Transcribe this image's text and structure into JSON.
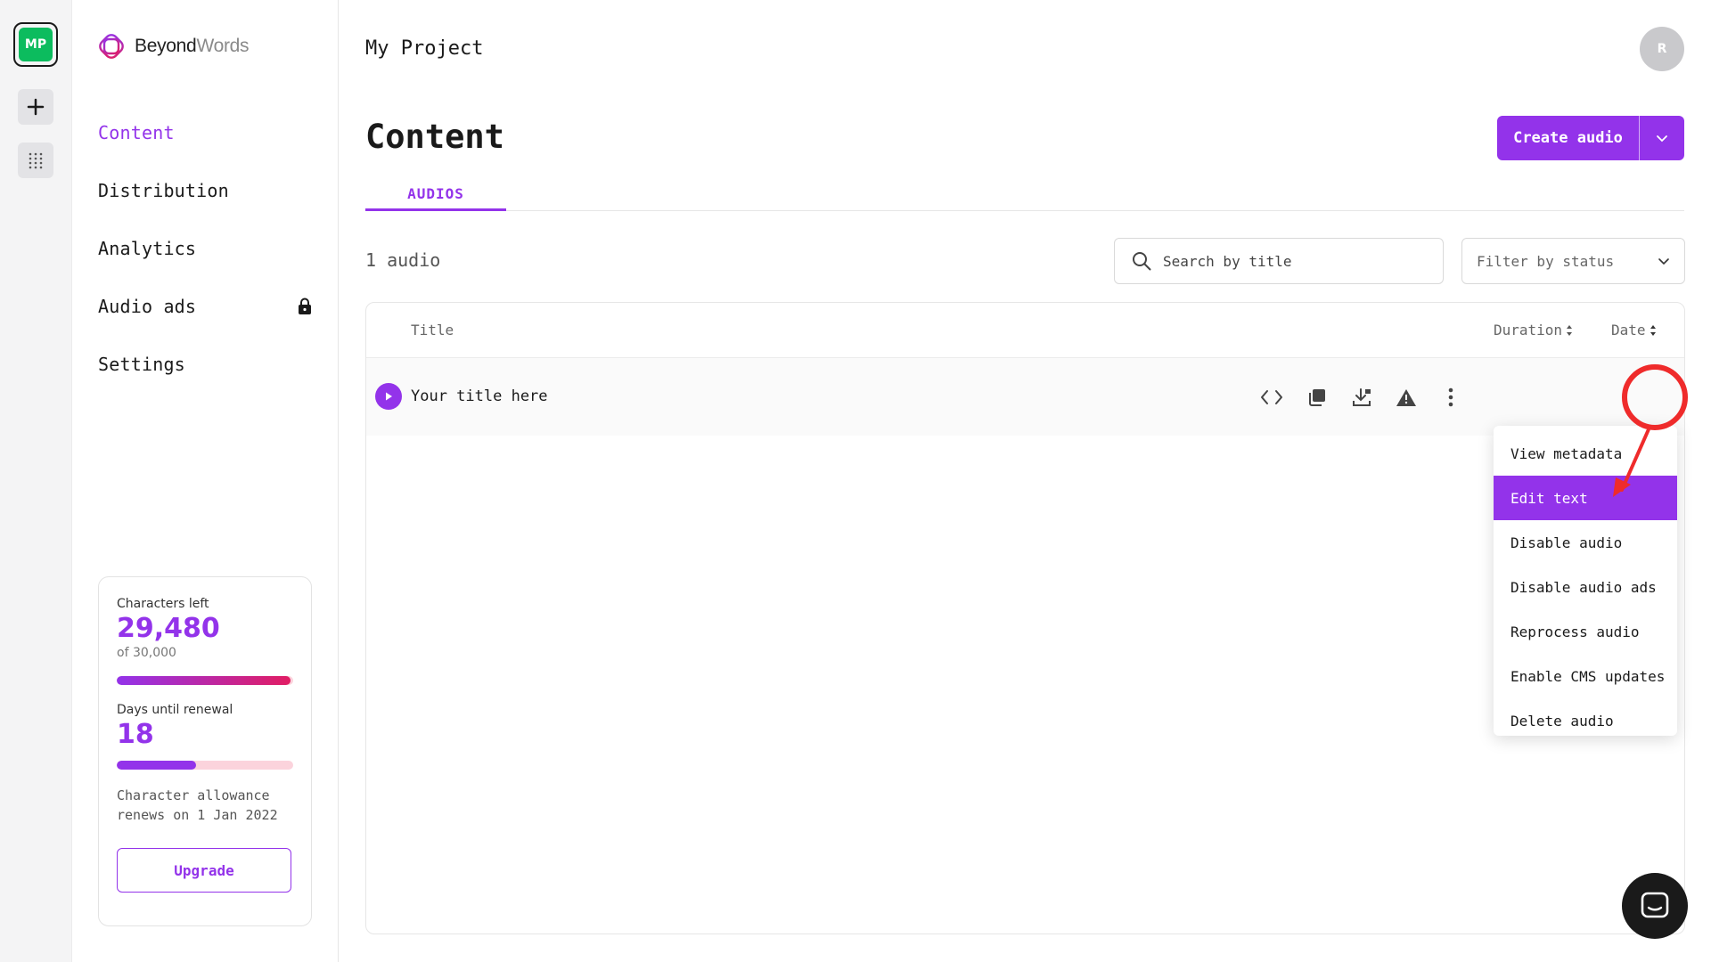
{
  "rail": {
    "workspace_initials": "MP"
  },
  "brand": {
    "name_bold": "Beyond",
    "name_light": "Words"
  },
  "sidebar": {
    "items": [
      {
        "label": "Content",
        "active": true
      },
      {
        "label": "Distribution"
      },
      {
        "label": "Analytics"
      },
      {
        "label": "Audio ads",
        "locked": true
      },
      {
        "label": "Settings"
      }
    ]
  },
  "usage": {
    "chars_label": "Characters left",
    "chars_value": "29,480",
    "chars_of": "of 30,000",
    "chars_fraction": 0.983,
    "days_label": "Days until renewal",
    "days_value": "18",
    "days_fraction": 0.45,
    "renew_text": "Character allowance renews on 1 Jan 2022",
    "upgrade_label": "Upgrade"
  },
  "header": {
    "project": "My Project",
    "avatar_initial": "R"
  },
  "page": {
    "title": "Content",
    "create_label": "Create audio",
    "tab": "AUDIOS",
    "count": "1 audio",
    "search_placeholder": "Search by title",
    "filter_label": "Filter by status"
  },
  "table": {
    "columns": {
      "title": "Title",
      "duration": "Duration",
      "date": "Date"
    },
    "rows": [
      {
        "title": "Your title here"
      }
    ]
  },
  "menu": {
    "items": [
      {
        "label": "View metadata"
      },
      {
        "label": "Edit text",
        "highlight": true
      },
      {
        "label": "Disable audio"
      },
      {
        "label": "Disable audio ads"
      },
      {
        "label": "Reprocess audio"
      },
      {
        "label": "Enable CMS updates"
      },
      {
        "label": "Delete audio"
      }
    ]
  },
  "colors": {
    "accent": "#9333ea",
    "workspace": "#0cbc5e",
    "annotation": "#ef2b2b"
  },
  "icons": [
    "plus-icon",
    "grid-icon",
    "lock-icon",
    "search-icon",
    "chevron-down-icon",
    "play-icon",
    "code-icon",
    "copy-icon",
    "download-icon",
    "warning-icon",
    "more-vertical-icon",
    "chat-icon"
  ]
}
